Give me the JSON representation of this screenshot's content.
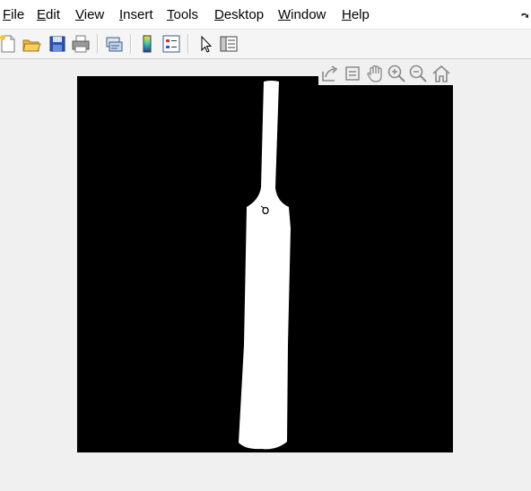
{
  "menubar": {
    "items": [
      {
        "mnemonic": "F",
        "rest": "ile"
      },
      {
        "mnemonic": "E",
        "rest": "dit"
      },
      {
        "mnemonic": "V",
        "rest": "iew"
      },
      {
        "mnemonic": "I",
        "rest": "nsert"
      },
      {
        "mnemonic": "T",
        "rest": "ools"
      },
      {
        "mnemonic": "D",
        "rest": "esktop"
      },
      {
        "mnemonic": "W",
        "rest": "indow"
      },
      {
        "mnemonic": "H",
        "rest": "elp"
      }
    ],
    "corner_icon": "dock-arrow-icon"
  },
  "toolbar": {
    "buttons": [
      "new-figure-icon",
      "open-file-icon",
      "save-icon",
      "print-icon",
      "link-plot-icon",
      "colorbar-icon",
      "legend-icon",
      "edit-plot-pointer-icon",
      "property-inspector-icon"
    ]
  },
  "axes_toolbar": {
    "buttons": [
      "export-icon",
      "data-tips-icon",
      "pan-hand-icon",
      "zoom-in-icon",
      "zoom-out-icon",
      "restore-view-home-icon"
    ]
  },
  "figure": {
    "image_description_colors": {
      "background": "#000000",
      "foreground": "#ffffff"
    }
  }
}
